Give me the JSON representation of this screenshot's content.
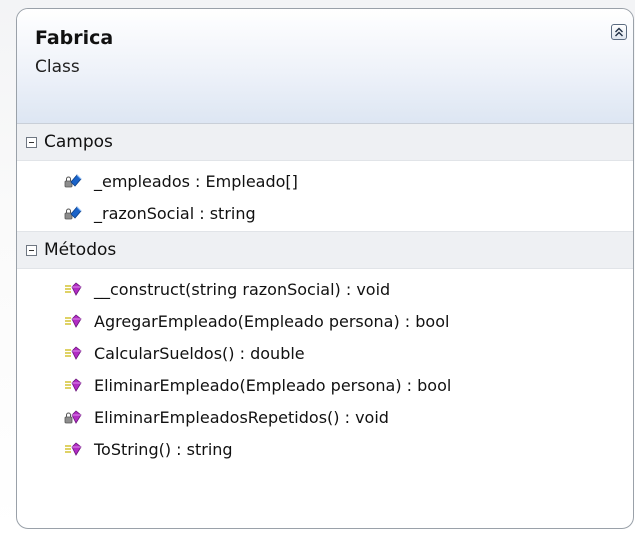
{
  "class": {
    "name": "Fabrica",
    "kind": "Class"
  },
  "sections": {
    "fields": {
      "label": "Campos",
      "items": [
        {
          "text": "_empleados : Empleado[]",
          "icon": "private-field-icon"
        },
        {
          "text": "_razonSocial : string",
          "icon": "private-field-icon"
        }
      ]
    },
    "methods": {
      "label": "Métodos",
      "items": [
        {
          "text": "__construct(string razonSocial) : void",
          "icon": "public-method-icon"
        },
        {
          "text": "AgregarEmpleado(Empleado persona) : bool",
          "icon": "public-method-icon"
        },
        {
          "text": "CalcularSueldos() : double",
          "icon": "public-method-icon"
        },
        {
          "text": "EliminarEmpleado(Empleado persona) : bool",
          "icon": "public-method-icon"
        },
        {
          "text": "EliminarEmpleadosRepetidos() : void",
          "icon": "private-method-icon"
        },
        {
          "text": "ToString() : string",
          "icon": "public-method-icon"
        }
      ]
    }
  },
  "colors": {
    "field_icon": "#1a63c9",
    "method_icon": "#b22cc4",
    "border": "#9aa1a9",
    "header_gradient_end": "#dde6f3"
  }
}
